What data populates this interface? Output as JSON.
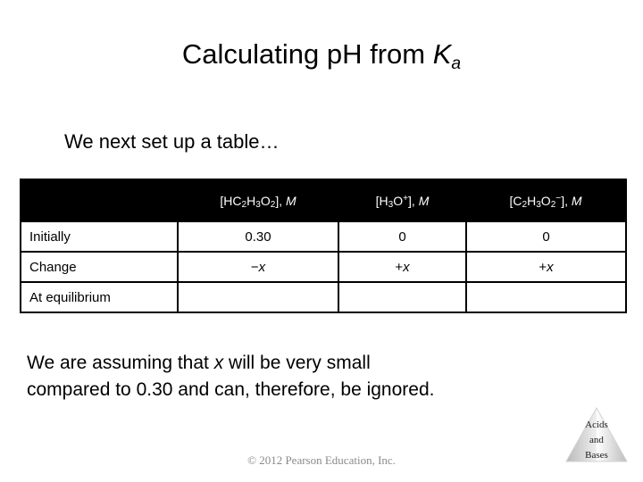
{
  "slide": {
    "title_prefix": "Calculating pH from ",
    "title_symbol": "K",
    "title_symbol_sub": "a",
    "intro": "We next set up a table…"
  },
  "table": {
    "corner_header": "",
    "headers": [
      {
        "prefix": "[HC",
        "s1": "2",
        "mid1": "H",
        "s2": "3",
        "mid2": "O",
        "s3": "2",
        "suffix": "], ",
        "unit": "M",
        "plain": "[HC2H3O2], M"
      },
      {
        "prefix": "[H",
        "s1": "3",
        "mid1": "O",
        "charge": "+",
        "suffix": "], ",
        "unit": "M",
        "plain": "[H3O+], M"
      },
      {
        "prefix": "[C",
        "s1": "2",
        "mid1": "H",
        "s2": "3",
        "mid2": "O",
        "s3": "2",
        "charge": "−",
        "suffix": "], ",
        "unit": "M",
        "plain": "[C2H3O2-], M"
      }
    ],
    "rows": [
      {
        "label": "Initially",
        "c1": "0.30",
        "c2": "0",
        "c3": "0"
      },
      {
        "label": "Change",
        "c1_sign": "−",
        "c1_var": "x",
        "c2_sign": "+",
        "c2_var": "x",
        "c3_sign": "+",
        "c3_var": "x"
      },
      {
        "label": "At equilibrium",
        "c1": "",
        "c2": "",
        "c3": ""
      }
    ]
  },
  "body": {
    "assume_line1_a": "We are assuming that ",
    "assume_line1_var": "x",
    "assume_line1_b": " will be very small",
    "assume_line2": "compared to 0.30 and can, therefore, be ignored."
  },
  "logo": {
    "line1": "Acids",
    "line2": "and",
    "line3": "Bases"
  },
  "footer": {
    "copyright": "© 2012 Pearson Education, Inc."
  },
  "colors": {
    "header_bg": "#000000",
    "header_fg": "#ffffff",
    "text": "#000000",
    "copyright": "#8a8a8a",
    "logo_gray": "#c9c9c9"
  }
}
